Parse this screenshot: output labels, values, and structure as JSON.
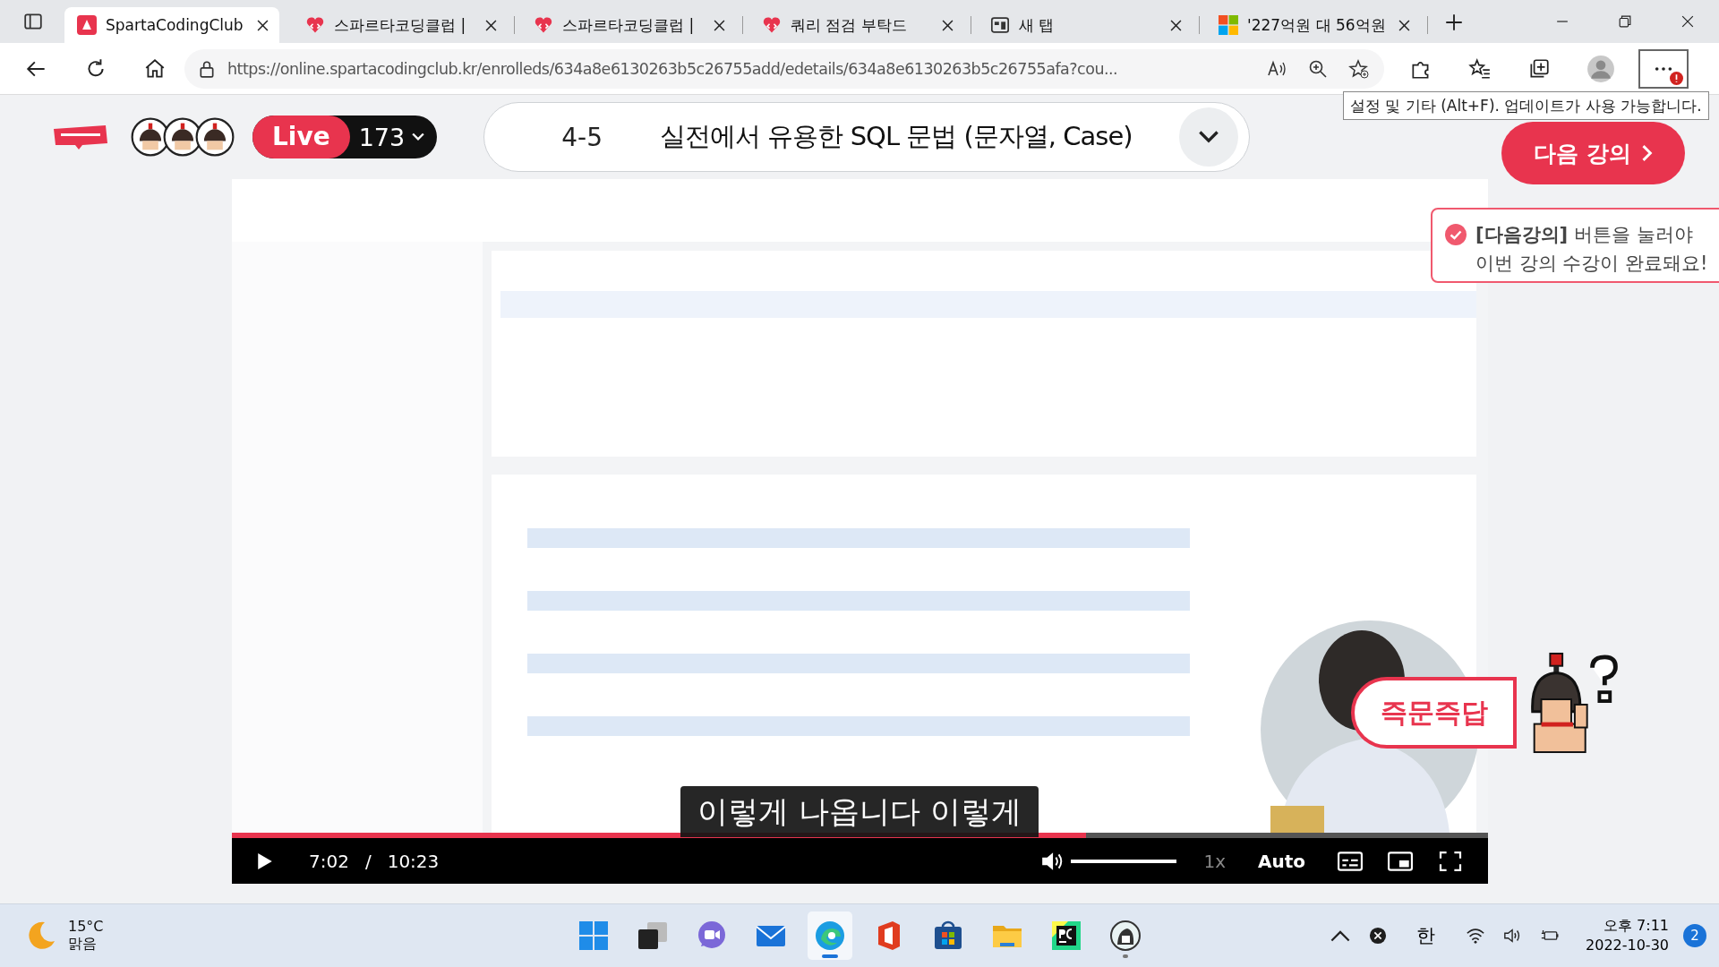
{
  "browser": {
    "tabs": [
      {
        "title": "SpartaCodingClub",
        "selected": true
      },
      {
        "title": "스파르타코딩클럽 |",
        "selected": false
      },
      {
        "title": "스파르타코딩클럽 |",
        "selected": false
      },
      {
        "title": "쿼리 점검 부탁드",
        "selected": false
      },
      {
        "title": "새 탭",
        "selected": false
      },
      {
        "title": "'227억원 대 56억원",
        "selected": false
      }
    ],
    "address": "https://online.spartacodingclub.kr/enrolleds/634a8e6130263b5c26755add/edetails/634a8e6130263b5c26755afa?cou...",
    "tooltip": "설정 및 기타 (Alt+F). 업데이트가 사용 가능합니다."
  },
  "header": {
    "live_label": "Live",
    "viewers": "173",
    "lesson_number": "4-5",
    "lesson_title": "실전에서 유용한 SQL 문법 (문자열, Case)",
    "next_button": "다음 강의"
  },
  "notice": {
    "text": "**[다음강의]** 버튼을 눌러야\n이번 강의 수강이 완료돼요!"
  },
  "video": {
    "kind": "picture",
    "subtitle": "이렇게 나옵니다 이렇게",
    "progress": {
      "level": 0.68
    },
    "current_time": "7:02",
    "separator": "/",
    "duration": "10:23",
    "volume": {
      "level": 1.0
    },
    "speed": "1x",
    "quality": "Auto"
  },
  "qa_badge": "즉문즉답",
  "taskbar": {
    "weather": {
      "temperature": "15°C",
      "condition": "맑음"
    },
    "apps": [
      {
        "active": false,
        "running": false
      },
      {
        "active": false,
        "running": false
      },
      {
        "active": false,
        "running": false
      },
      {
        "active": false,
        "running": false
      },
      {
        "active": true,
        "running": false
      },
      {
        "active": false,
        "running": false
      },
      {
        "active": false,
        "running": false
      },
      {
        "active": false,
        "running": false
      },
      {
        "active": false,
        "running": false
      },
      {
        "active": false,
        "running": true
      }
    ],
    "ime": "한",
    "time": "오후 7:11",
    "date": "2022-10-30",
    "notifications": "2"
  }
}
